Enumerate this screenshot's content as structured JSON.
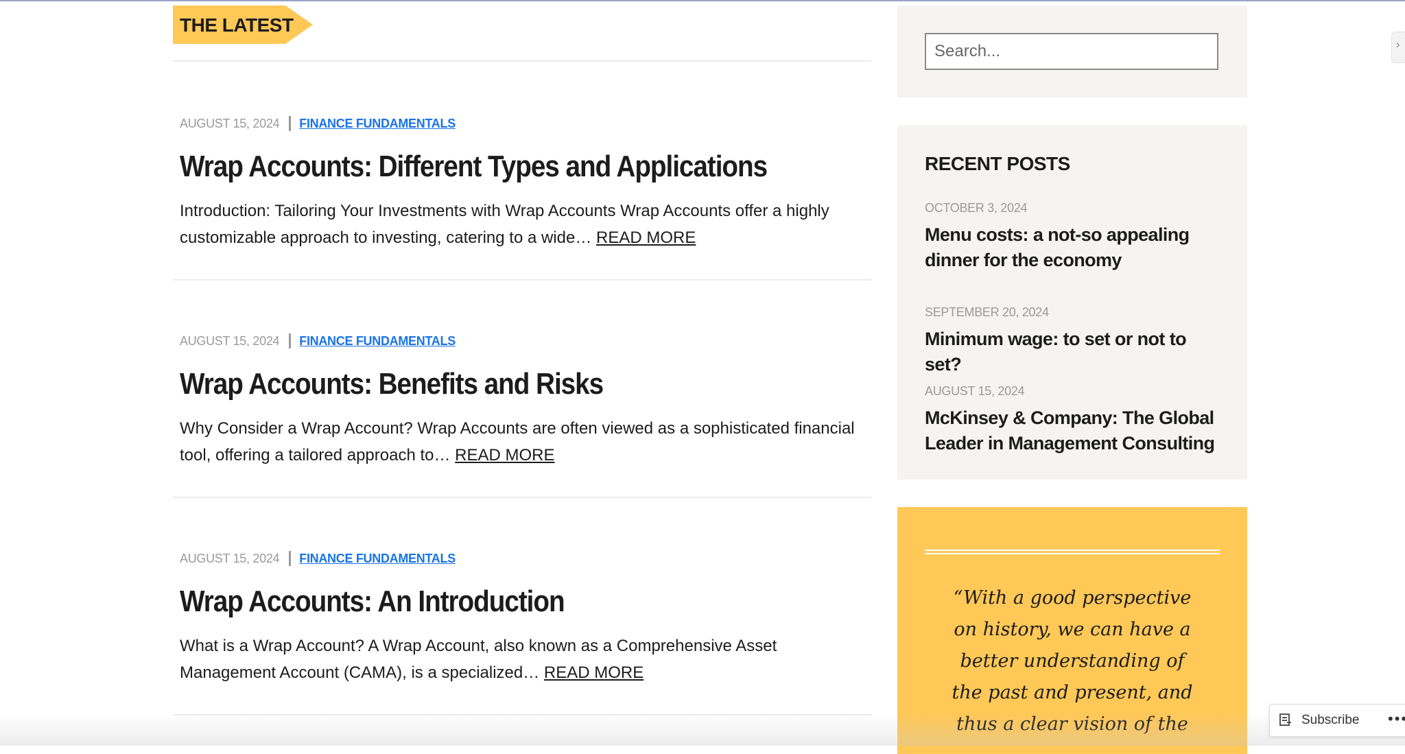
{
  "main": {
    "section_label": "THE LATEST",
    "posts": [
      {
        "date": "AUGUST 15, 2024",
        "category": "FINANCE FUNDAMENTALS",
        "title": "Wrap Accounts: Different Types and Applications",
        "excerpt": "Introduction: Tailoring Your Investments with Wrap Accounts Wrap Accounts offer a highly customizable approach to investing, catering to a wide…",
        "read_more": "READ MORE"
      },
      {
        "date": "AUGUST 15, 2024",
        "category": "FINANCE FUNDAMENTALS",
        "title": "Wrap Accounts: Benefits and Risks",
        "excerpt": "Why Consider a Wrap Account? Wrap Accounts are often viewed as a sophisticated financial tool, offering a tailored approach to…",
        "read_more": "READ MORE"
      },
      {
        "date": "AUGUST 15, 2024",
        "category": "FINANCE FUNDAMENTALS",
        "title": "Wrap Accounts: An Introduction",
        "excerpt": "What is a Wrap Account? A Wrap Account, also known as a Comprehensive Asset Management Account (CAMA), is a specialized…",
        "read_more": "READ MORE"
      }
    ]
  },
  "sidebar": {
    "search": {
      "placeholder": "Search..."
    },
    "recent_posts": {
      "title": "RECENT POSTS",
      "items": [
        {
          "date": "OCTOBER 3, 2024",
          "title": "Menu costs: a not-so appealing dinner for the economy"
        },
        {
          "date": "SEPTEMBER 20, 2024",
          "title": "Minimum wage: to set or not to set?"
        },
        {
          "date": "AUGUST 15, 2024",
          "title": "McKinsey & Company: The Global Leader in Management Consulting"
        }
      ]
    },
    "quote": {
      "text": "“With a good perspective on history, we can have a better understanding of the past and present, and thus a clear vision of the"
    }
  },
  "floating": {
    "subscribe_label": "Subscribe",
    "more_label": "•••",
    "edge_tab_glyph": "›"
  },
  "colors": {
    "accent_yellow": "#ffc857",
    "category_link": "#1a73e8",
    "widget_bg": "#f5f4f0",
    "muted_text": "#9a9a9a"
  }
}
